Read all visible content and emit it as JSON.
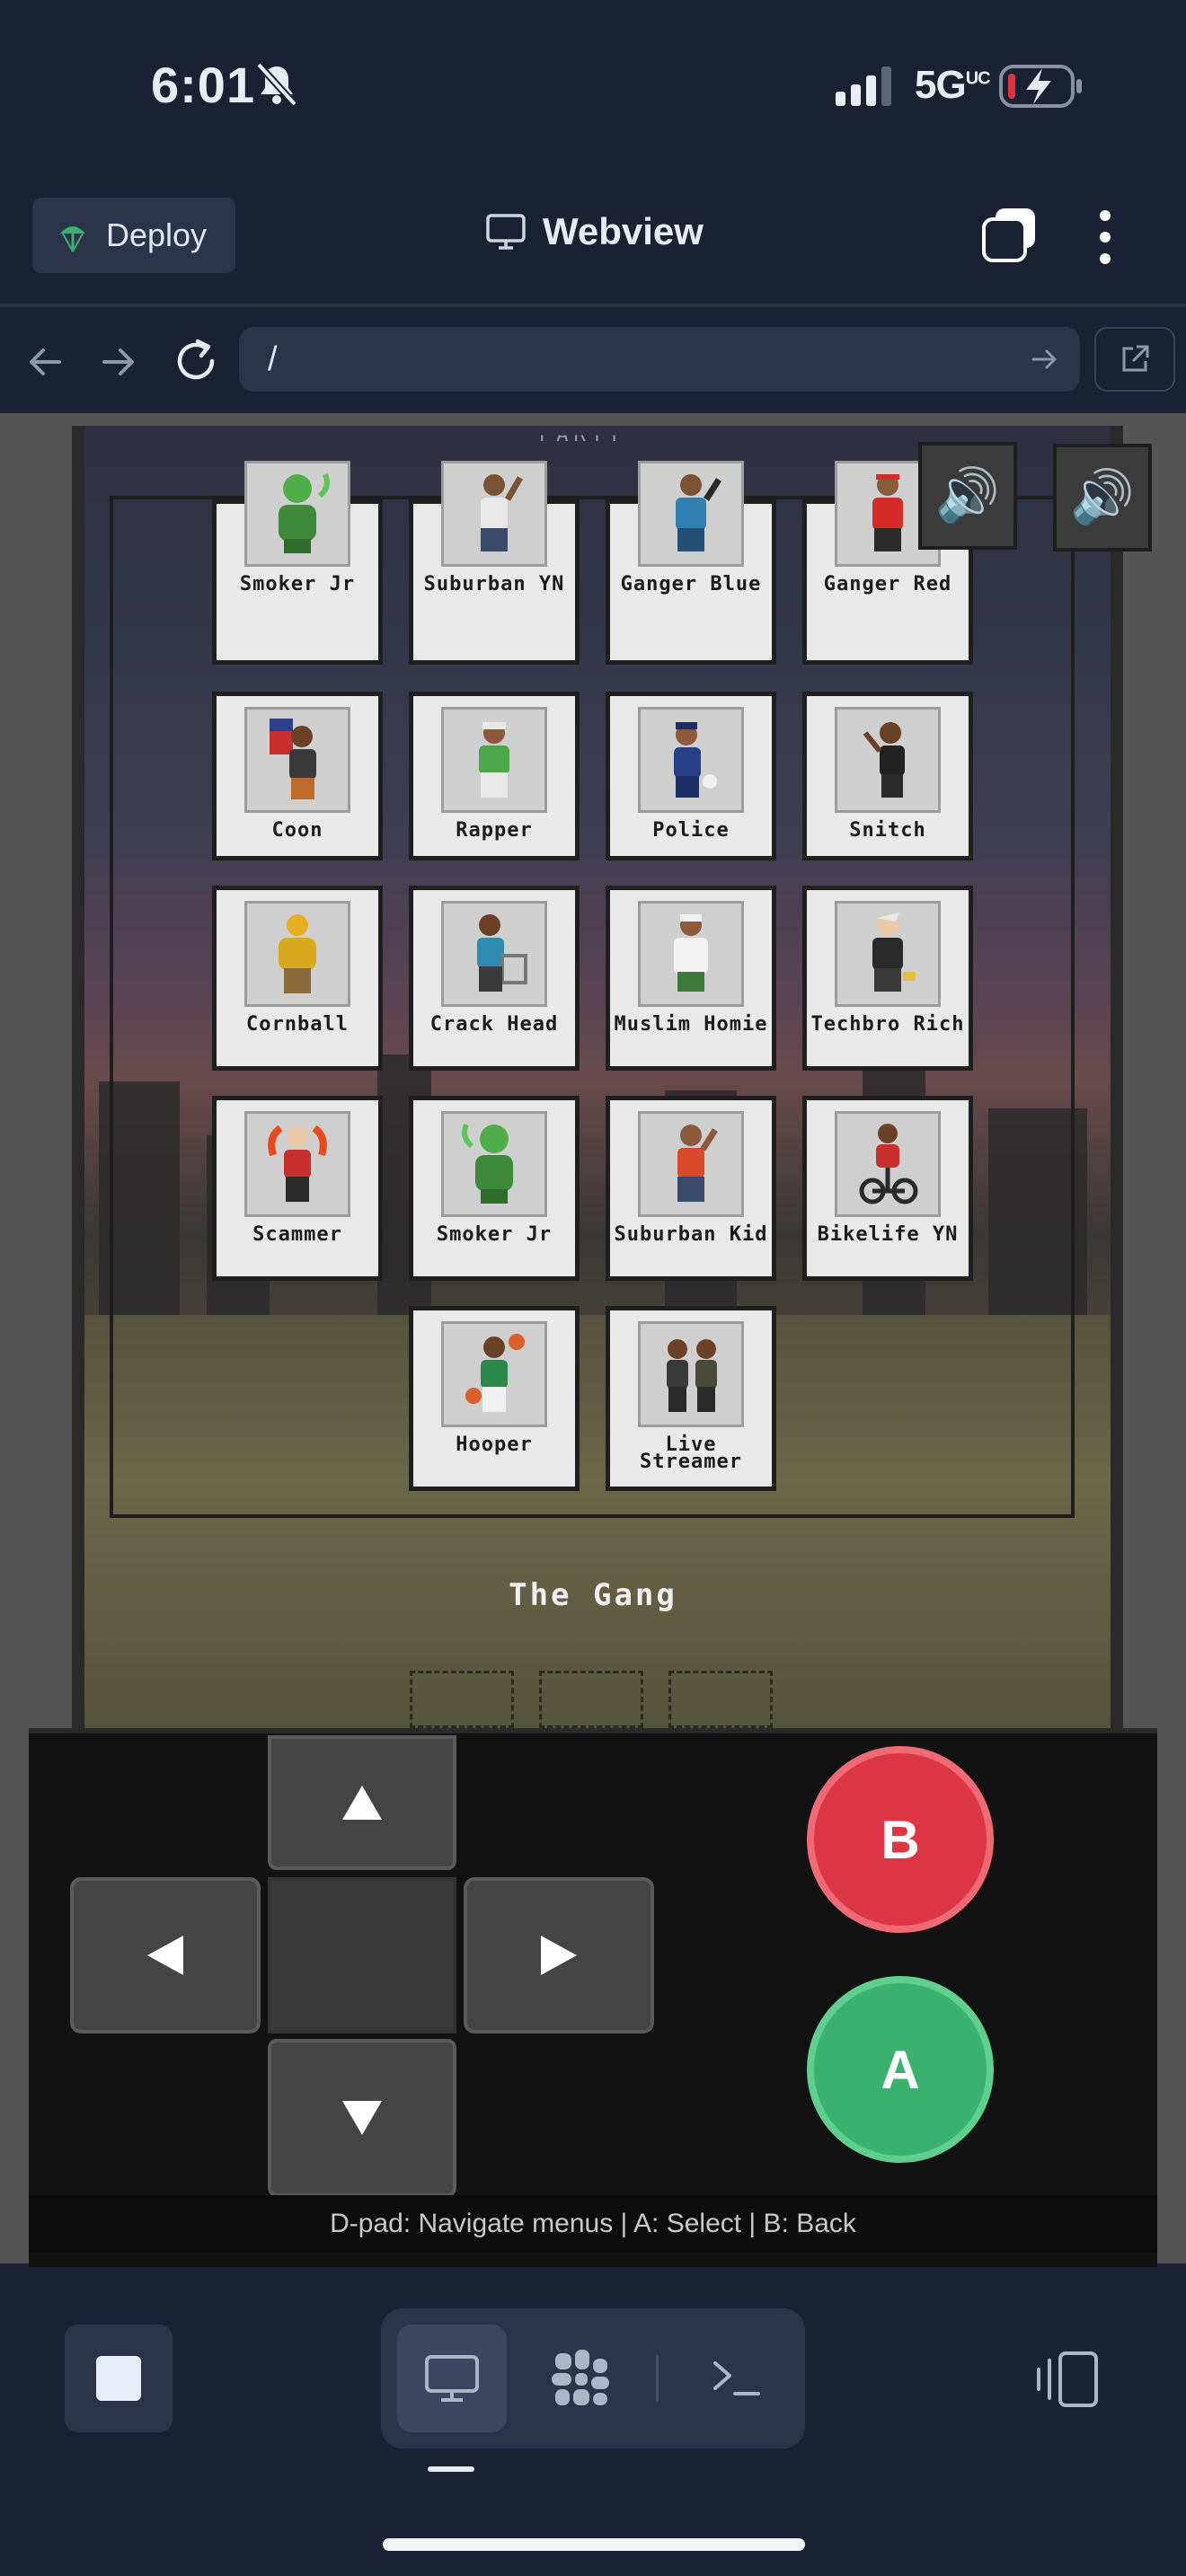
{
  "status_bar": {
    "time": "6:01",
    "network": "5G",
    "network_sup": "UC"
  },
  "header": {
    "deploy_label": "Deploy",
    "title": "Webview"
  },
  "url_bar": {
    "value": "/"
  },
  "game": {
    "screen_title": "The Gang",
    "top_cut_text": "PARTY",
    "characters": [
      {
        "name": "Smoker Jr"
      },
      {
        "name": "Suburban YN"
      },
      {
        "name": "Ganger Blue"
      },
      {
        "name": "Ganger Red"
      },
      {
        "name": "Coon"
      },
      {
        "name": "Rapper"
      },
      {
        "name": "Police"
      },
      {
        "name": "Snitch"
      },
      {
        "name": "Cornball"
      },
      {
        "name": "Crack Head"
      },
      {
        "name": "Muslim Homie"
      },
      {
        "name": "Techbro Rich"
      },
      {
        "name": "Scammer"
      },
      {
        "name": "Smoker Jr"
      },
      {
        "name": "Suburban Kid"
      },
      {
        "name": "Bikelife YN"
      },
      {
        "name": "Hooper"
      },
      {
        "name": "Live Streamer"
      }
    ]
  },
  "controller": {
    "b_label": "B",
    "a_label": "A",
    "help_text": "D-pad: Navigate menus | A: Select | B: Back"
  },
  "icons": {
    "deploy": "deploy-icon",
    "webview": "monitor-icon",
    "sound": "speaker-icon"
  },
  "colors": {
    "b_button": "#dc3545",
    "a_button": "#3ab16d",
    "app_background": "#1a2133"
  }
}
